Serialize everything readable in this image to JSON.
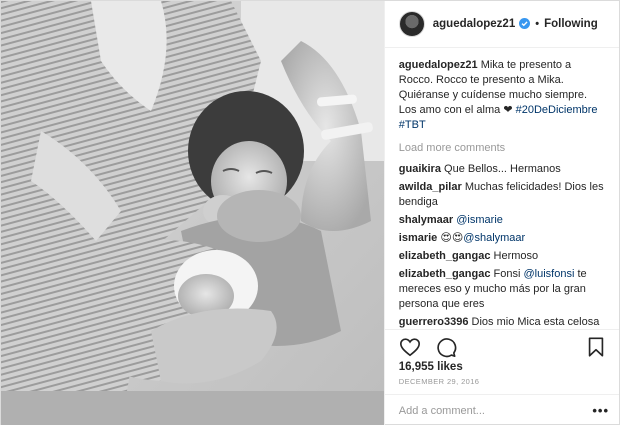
{
  "header": {
    "username": "aguedalopez21",
    "separator": "•",
    "follow_status": "Following"
  },
  "caption": {
    "username": "aguedalopez21",
    "text": "Mika te presento a Rocco. Rocco te presento a Mika. Quiéranse y cuídense mucho siempre. Los amo con el alma ❤",
    "hashtags": [
      "#20DeDiciembre",
      "#TBT"
    ]
  },
  "load_more": "Load more comments",
  "comments": [
    {
      "user": "guaikira",
      "text": "Que Bellos... Hermanos"
    },
    {
      "user": "awilda_pilar",
      "text": "Muchas felicidades! Dios les bendiga"
    },
    {
      "user": "shalymaar",
      "mention": "@ismarie",
      "text": ""
    },
    {
      "user": "ismarie",
      "emoji": "😍😍",
      "mention": "@shalymaar",
      "text": ""
    },
    {
      "user": "elizabeth_gangac",
      "text": "Hermoso"
    },
    {
      "user": "elizabeth_gangac",
      "prefix": "Fonsi",
      "mention": "@luisfonsi",
      "text": "te mereces eso y mucho más por la gran persona que eres"
    },
    {
      "user": "guerrero3396",
      "text": "Dios mio Mica esta celosa cosita"
    }
  ],
  "likes": "16,955 likes",
  "date": "DECEMBER 29, 2016",
  "add_comment": {
    "placeholder": "Add a comment...",
    "more": "•••"
  },
  "icons": {
    "verified": "verified-badge-icon",
    "like": "heart-icon",
    "comment": "comment-icon",
    "save": "bookmark-icon",
    "more": "more-options-icon"
  },
  "colors": {
    "verified": "#3897f0",
    "link": "#003569",
    "muted": "#999999"
  }
}
